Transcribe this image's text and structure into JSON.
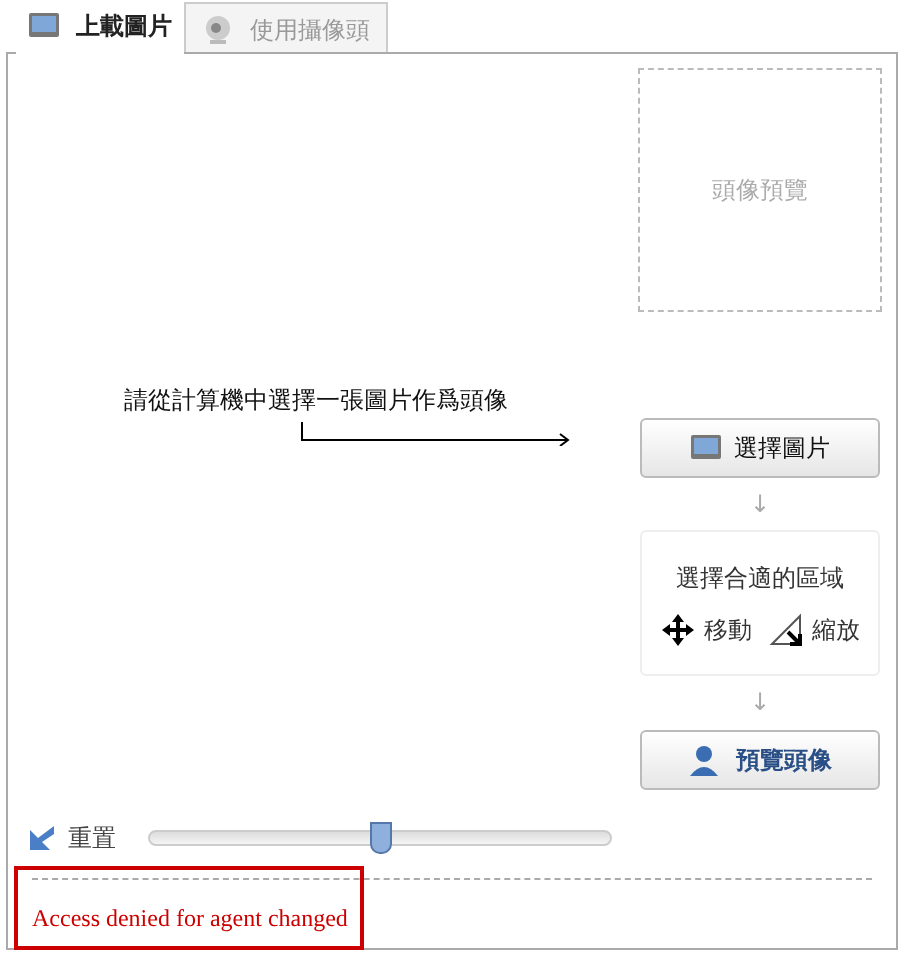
{
  "tabs": [
    {
      "label": "上載圖片",
      "selected": true,
      "kind": "picture"
    },
    {
      "label": "使用攝像頭",
      "selected": false,
      "kind": "camera"
    }
  ],
  "preview": {
    "label": "頭像預覽"
  },
  "instruction": "請從計算機中選擇一張圖片作爲頭像",
  "choose_button": "選擇圖片",
  "step_arrows": [
    "↓",
    "↓"
  ],
  "area_box": {
    "title": "選擇合適的區域",
    "move": "移動",
    "zoom": "縮放"
  },
  "preview_button": "預覽頭像",
  "reset": {
    "label": "重置",
    "level": 0.5
  },
  "error": "Access denied for agent changed"
}
